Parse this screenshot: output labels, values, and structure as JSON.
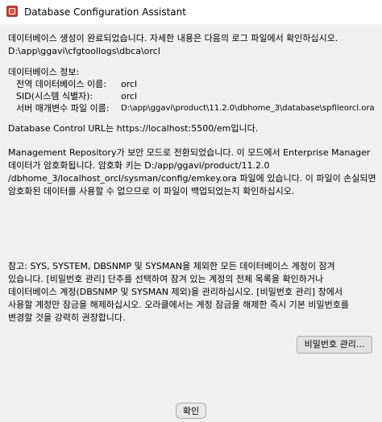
{
  "window": {
    "title": "Database Configuration Assistant"
  },
  "message": {
    "completed": "데이터베이스 생성이 완료되었습니다. 자세한 내용은 다음의 로그 파일에서 확인하십시오.",
    "log_path": "D:\\app\\ggavi\\cfgtoollogs\\dbca\\orcl",
    "info_header": "데이터베이스 정보:",
    "info": [
      {
        "label": "전역 데이터베이스 이름:",
        "value": "orcl"
      },
      {
        "label": "SID(시스템 식별자):",
        "value": "orcl"
      },
      {
        "label": "서버 매개변수 파일 이름:",
        "value": "D:\\app\\ggavi\\product\\11.2.0\\dbhome_3\\database\\spfileorcl.ora"
      }
    ],
    "control_url": "Database Control URL는 https://localhost:5500/em입니다.",
    "repository": [
      "Management Repository가 보안 모드로 전환되었습니다. 이 모드에서 Enterprise Manager",
      "데이터가 암호화됩니다. 암호화 키는 D:/app/ggavi/product/11.2.0",
      "/dbhome_3/localhost_orcl/sysman/config/emkey.ora 파일에 있습니다. 이 파일이 손실되면",
      "암호화된 데이터를 사용할 수 없으므로 이 파일이 백업되었는지 확인하십시오."
    ],
    "note": [
      "참고: SYS, SYSTEM, DBSNMP 및 SYSMAN을 제외한 모든 데이터베이스 계정이 잠겨",
      "있습니다. [비밀번호 관리] 단추를 선택하여 잠겨 있는 계정의 전체 목록을 확인하거나",
      "데이터베이스 계정(DBSNMP 및 SYSMAN 제외)을 관리하십시오. [비밀번호 관리] 창에서",
      "사용할 계정만 잠금을 해제하십시오. 오라클에서는 계정 잠금을 해제한 즉시 기본 비밀번호를",
      "변경할 것을 강력히 권장합니다."
    ]
  },
  "buttons": {
    "password_management": "비밀번호 관리...",
    "ok": "확인"
  }
}
